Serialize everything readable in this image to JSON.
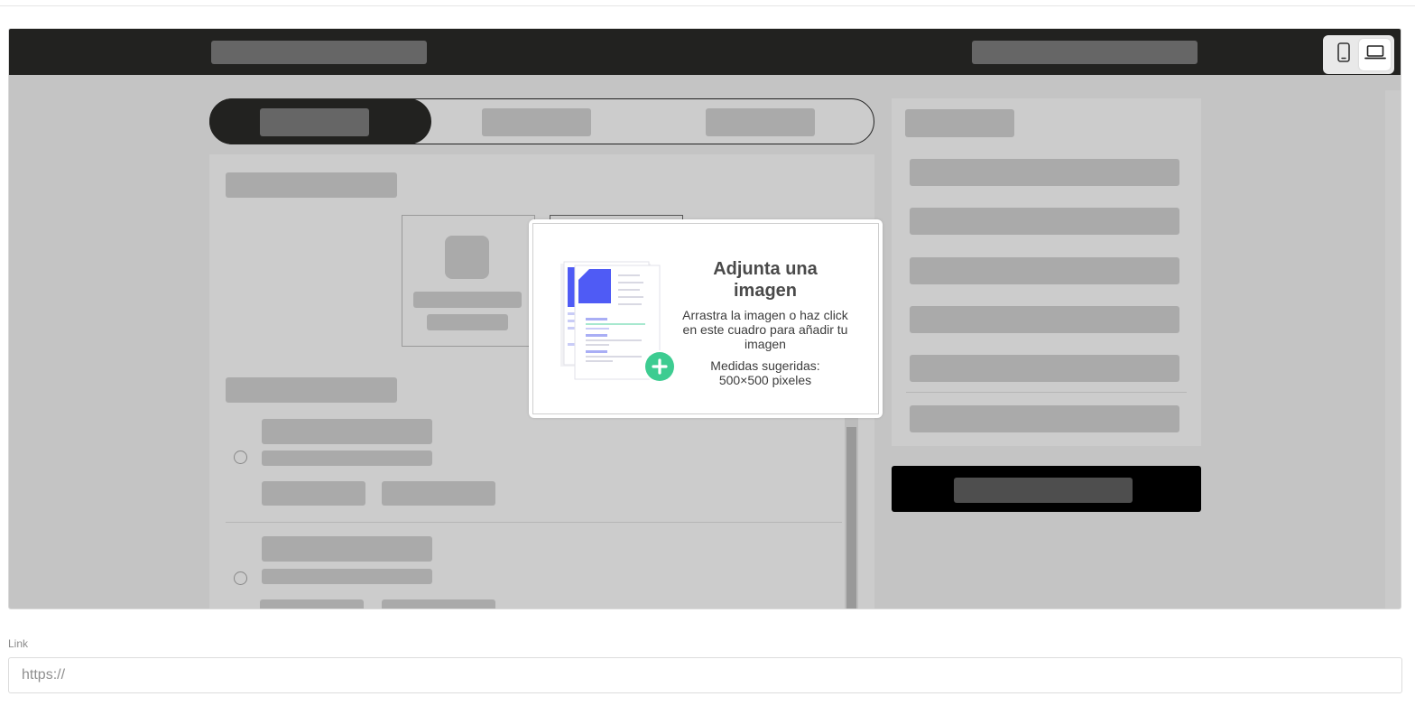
{
  "upload_dialog": {
    "title": "Adjunta una imagen",
    "description": "Arrastra la imagen o haz click en este cuadro para añadir tu imagen",
    "size_hint_line1": "Medidas sugeridas:",
    "size_hint_line2": "500×500 pixeles",
    "illustration_icon": "documents-add-icon",
    "accent_color": "#4f5bf5",
    "add_color": "#3dcc91"
  },
  "device_toggle": {
    "options": [
      "mobile-icon",
      "laptop-icon"
    ],
    "selected": "laptop-icon"
  },
  "link_field": {
    "label": "Link",
    "placeholder": "https://",
    "value": ""
  },
  "colors": {
    "preview_header": "#222220",
    "preview_background": "#c4c4c4",
    "cta_button": "#000000"
  }
}
